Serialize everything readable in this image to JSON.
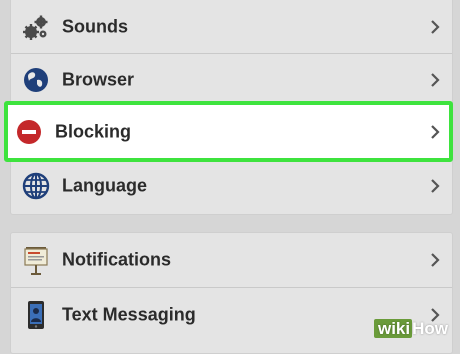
{
  "settings_group_1": {
    "items": [
      {
        "label": "Sounds",
        "icon": "gears-icon"
      },
      {
        "label": "Browser",
        "icon": "globe-earth-icon"
      },
      {
        "label": "Blocking",
        "icon": "blocked-icon"
      },
      {
        "label": "Language",
        "icon": "globe-grid-icon"
      }
    ]
  },
  "settings_group_2": {
    "items": [
      {
        "label": "Notifications",
        "icon": "notification-board-icon"
      },
      {
        "label": "Text Messaging",
        "icon": "phone-icon"
      }
    ]
  },
  "highlight_color": "#3ee33e",
  "watermark": {
    "part1": "wiki",
    "part2": "How"
  }
}
